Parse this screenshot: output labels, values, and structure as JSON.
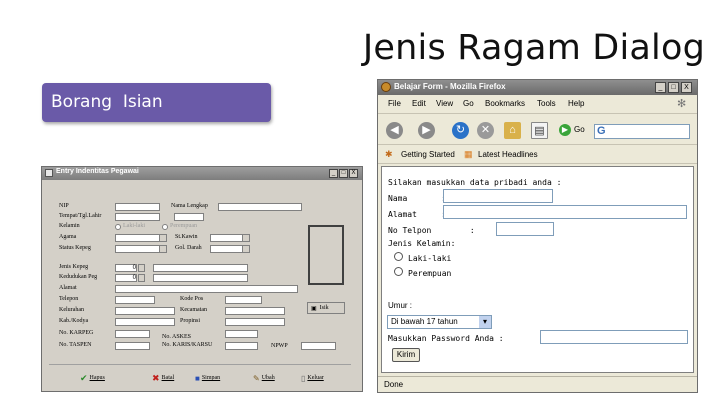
{
  "slide": {
    "title": "Jenis Ragam Dialog",
    "label": "Borang  Isian"
  },
  "left_window": {
    "title": "Entry Indentitas Pegawai",
    "controls": {
      "minimize": "_",
      "maximize": "□",
      "close": "X"
    },
    "fields": {
      "nip": "NIP",
      "nama_lengkap": "Nama Lengkap",
      "tempat_tgl_lahir": "Tempat/Tgl.Lahir",
      "kelamin": "Kelamin",
      "laki_laki": "Laki-laki",
      "perempuan": "Perempuan",
      "agama": "Agama",
      "st_kawin": "St.Kawin",
      "status_kepeg": "Status Kepeg",
      "gol_darah": "Gol. Darah",
      "jenis_kepeg": "Jenis Kepeg",
      "kedudukan_peg": "Kedudukan Peg",
      "alamat": "Alamat",
      "telepon": "Telepon",
      "kode_pos": "Kode Pos",
      "kelurahan": "Kelurahan",
      "kecamatan": "Kecamatan",
      "kab_kodya": "Kab./Kodya",
      "propinsi": "Propinsi",
      "no_karpeg": "No. KARPEG",
      "no_askes": "No. ASKES",
      "no_taspen": "No. TASPEN",
      "no_karis_karsu": "No. KARIS/KARSU",
      "npwp": "NPWP",
      "jenis_kepeg_value": "0",
      "kedudukan_peg_value": "0"
    },
    "tool_button": "Isik",
    "buttons": {
      "hapus": "Hapus",
      "batal": "Batal",
      "simpan": "Simpan",
      "ubah": "Ubah",
      "keluar": "Keluar"
    }
  },
  "firefox": {
    "title": "Belajar Form - Mozilla Firefox",
    "controls": {
      "minimize": "_",
      "maximize": "□",
      "close": "X"
    },
    "menu": [
      "File",
      "Edit",
      "View",
      "Go",
      "Bookmarks",
      "Tools",
      "Help"
    ],
    "go_label": "Go",
    "bookmarks": [
      "Getting Started",
      "Latest Headlines"
    ],
    "form": {
      "intro": "Silakan masukkan data pribadi anda :",
      "nama": "Nama       :",
      "alamat": "Alamat     :",
      "no_telpon": "No Telpon        :",
      "jenis_kelamin": "Jenis Kelamin:",
      "laki_laki": "Laki-laki",
      "perempuan": "Perempuan",
      "umur": "Umur :",
      "umur_selected": "Di bawah 17 tahun",
      "password": "Masukkan Password Anda :",
      "kirim": "Kirim"
    },
    "status": "Done"
  }
}
